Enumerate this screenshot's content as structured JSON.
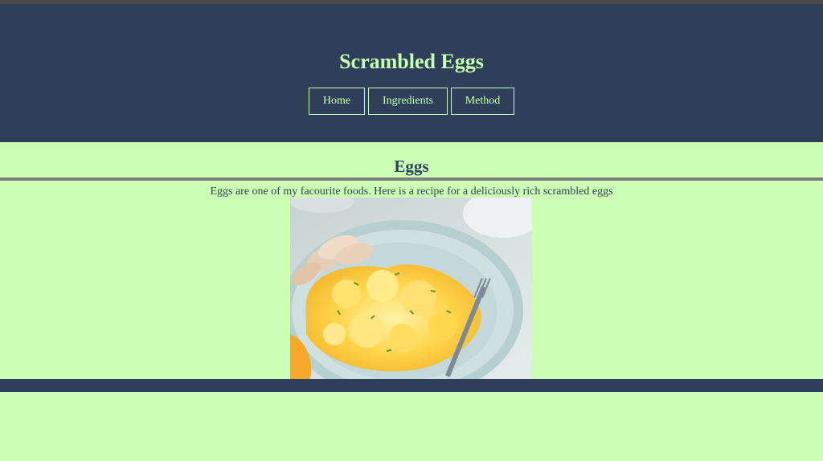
{
  "header": {
    "title": "Scrambled Eggs",
    "nav": [
      {
        "label": "Home"
      },
      {
        "label": "Ingredients"
      },
      {
        "label": "Method"
      }
    ]
  },
  "main": {
    "heading": "Eggs",
    "intro": "Eggs are one of my facourite foods. Here is a recipe for a deliciously rich scrambled eggs"
  },
  "colors": {
    "header_bg": "#2e4059",
    "page_bg": "#ccffb4",
    "accent_text": "#c9ffb0",
    "rule": "#7f7f7f"
  }
}
